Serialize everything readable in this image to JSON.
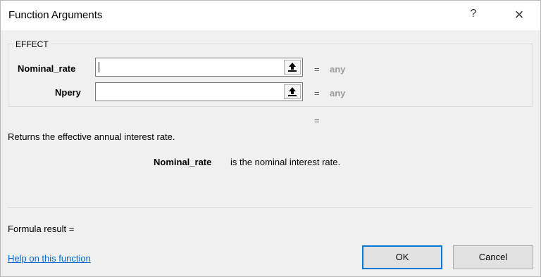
{
  "dialog": {
    "title": "Function Arguments",
    "help_glyph": "?",
    "close_glyph": "×"
  },
  "function": {
    "name": "EFFECT",
    "args": [
      {
        "label": "Nominal_rate",
        "value": "",
        "eq": "=",
        "result": "any"
      },
      {
        "label": "Npery",
        "value": "",
        "eq": "=",
        "result": "any"
      }
    ],
    "total_eq": "=",
    "description": "Returns the effective annual interest rate.",
    "arg_desc_name": "Nominal_rate",
    "arg_desc_text": "is the nominal interest rate."
  },
  "footer": {
    "formula_result": "Formula result =",
    "help_link": "Help on this function",
    "ok_label": "OK",
    "cancel_label": "Cancel"
  },
  "icons": {
    "collapse": "collapse-dialog-icon",
    "close": "close-icon",
    "help": "help-icon"
  },
  "colors": {
    "accent": "#0078d7",
    "link": "#0066cc"
  }
}
